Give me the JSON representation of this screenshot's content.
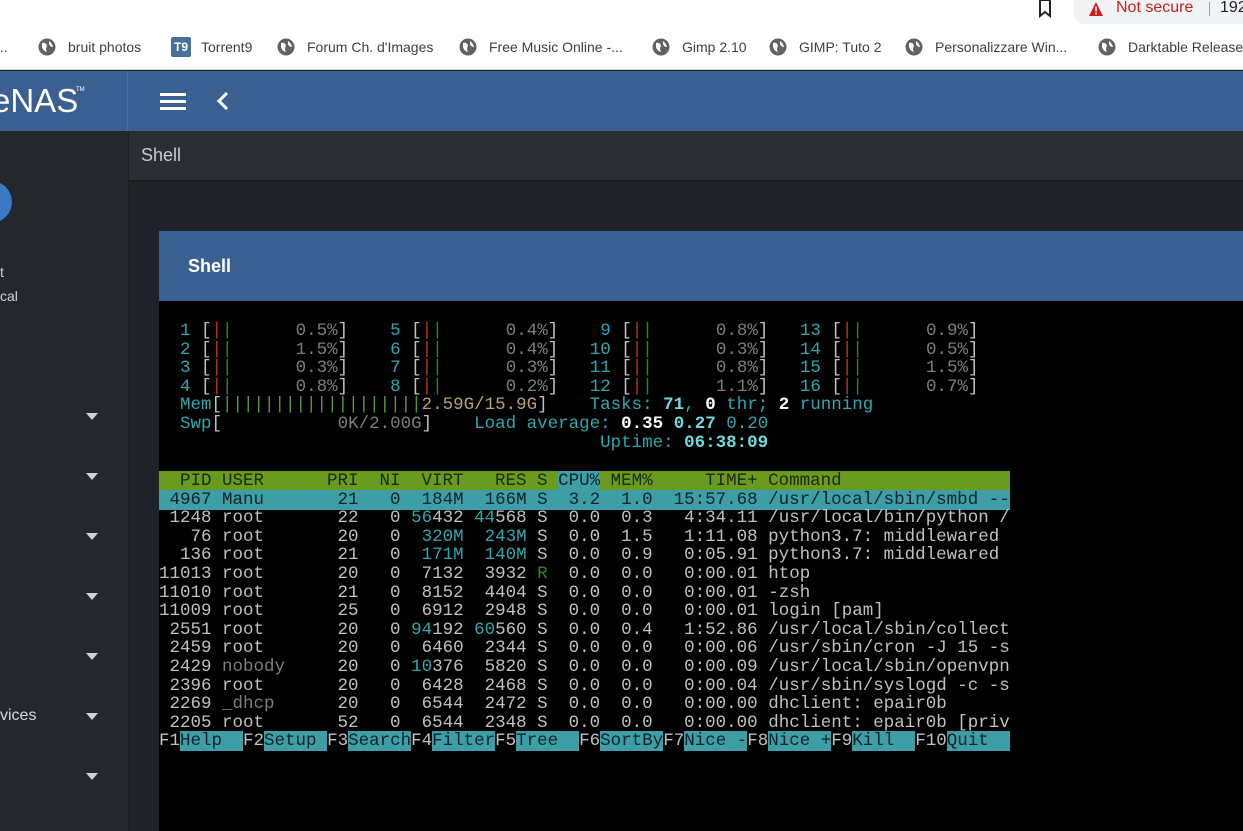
{
  "browser": {
    "not_secure": "Not secure",
    "url_fragment": "192",
    "bookmarks": [
      {
        "label": "bruit photos",
        "icon": "globe-icon"
      },
      {
        "label": "Torrent9",
        "icon": "torrent9-favicon"
      },
      {
        "label": "Forum Ch. d'Images",
        "icon": "globe-icon"
      },
      {
        "label": "Free Music Online -...",
        "icon": "globe-icon"
      },
      {
        "label": "Gimp 2.10",
        "icon": "globe-icon"
      },
      {
        "label": "GIMP: Tuto 2",
        "icon": "globe-icon"
      },
      {
        "label": "Personalizzare Win...",
        "icon": "globe-icon"
      },
      {
        "label": "Darktable Release",
        "icon": "globe-icon"
      }
    ],
    "torrent9_badge": "T9"
  },
  "app": {
    "logo": "eNAS",
    "logo_tm": "TM"
  },
  "sidebar": {
    "small_text": "t",
    "role_text": "cal",
    "items": [
      {
        "label": ""
      },
      {
        "label": ""
      },
      {
        "label": ""
      },
      {
        "label": ""
      },
      {
        "label": ""
      },
      {
        "label": "vices"
      },
      {
        "label": ""
      }
    ]
  },
  "page": {
    "title": "Shell",
    "card_title": "Shell"
  },
  "terminal": {
    "cpu": [
      [
        "1",
        "0.5%"
      ],
      [
        "2",
        "1.5%"
      ],
      [
        "3",
        "0.3%"
      ],
      [
        "4",
        "0.8%"
      ],
      [
        "5",
        "0.4%"
      ],
      [
        "6",
        "0.4%"
      ],
      [
        "7",
        "0.3%"
      ],
      [
        "8",
        "0.2%"
      ],
      [
        "9",
        "0.8%"
      ],
      [
        "10",
        "0.3%"
      ],
      [
        "11",
        "0.8%"
      ],
      [
        "12",
        "1.1%"
      ],
      [
        "13",
        "0.9%"
      ],
      [
        "14",
        "0.5%"
      ],
      [
        "15",
        "1.5%"
      ],
      [
        "16",
        "0.7%"
      ]
    ],
    "mem_label": "Mem",
    "mem_value": "2.59G/15.9G",
    "swp_label": "Swp",
    "swp_value": "0K/2.00G",
    "tasks_label": "Tasks:",
    "tasks_count": "71",
    "tasks_thr": "0",
    "thr_word": "thr;",
    "tasks_running": "2",
    "running_word": "running",
    "load_label": "Load average:",
    "load1": "0.35",
    "load5": "0.27",
    "load15": "0.20",
    "uptime_label": "Uptime:",
    "uptime": "06:38:09",
    "columns": [
      "PID",
      "USER",
      "PRI",
      "NI",
      "VIRT",
      "RES",
      "S",
      "CPU%",
      "MEM%",
      "TIME+",
      "Command"
    ],
    "processes": [
      {
        "pid": "4967",
        "user": "Manu",
        "pri": "21",
        "ni": "0",
        "virt": "184M",
        "res": "166M",
        "s": "S",
        "cpu": "3.2",
        "mem": "1.0",
        "time": "15:57.68",
        "cmd": "/usr/local/sbin/smbd --"
      },
      {
        "pid": "1248",
        "user": "root",
        "pri": "22",
        "ni": "0",
        "virt": "56432",
        "res": "44568",
        "s": "S",
        "cpu": "0.0",
        "mem": "0.3",
        "time": "4:34.11",
        "cmd": "/usr/local/bin/python /"
      },
      {
        "pid": "76",
        "user": "root",
        "pri": "20",
        "ni": "0",
        "virt": "320M",
        "res": "243M",
        "s": "S",
        "cpu": "0.0",
        "mem": "1.5",
        "time": "1:11.08",
        "cmd": "python3.7: middlewared"
      },
      {
        "pid": "136",
        "user": "root",
        "pri": "21",
        "ni": "0",
        "virt": "171M",
        "res": "140M",
        "s": "S",
        "cpu": "0.0",
        "mem": "0.9",
        "time": "0:05.91",
        "cmd": "python3.7: middlewared"
      },
      {
        "pid": "11013",
        "user": "root",
        "pri": "20",
        "ni": "0",
        "virt": "7132",
        "res": "3932",
        "s": "R",
        "cpu": "0.0",
        "mem": "0.0",
        "time": "0:00.01",
        "cmd": "htop"
      },
      {
        "pid": "11010",
        "user": "root",
        "pri": "21",
        "ni": "0",
        "virt": "8152",
        "res": "4404",
        "s": "S",
        "cpu": "0.0",
        "mem": "0.0",
        "time": "0:00.01",
        "cmd": "-zsh"
      },
      {
        "pid": "11009",
        "user": "root",
        "pri": "25",
        "ni": "0",
        "virt": "6912",
        "res": "2948",
        "s": "S",
        "cpu": "0.0",
        "mem": "0.0",
        "time": "0:00.01",
        "cmd": "login [pam]"
      },
      {
        "pid": "2551",
        "user": "root",
        "pri": "20",
        "ni": "0",
        "virt": "94192",
        "res": "60560",
        "s": "S",
        "cpu": "0.0",
        "mem": "0.4",
        "time": "1:52.86",
        "cmd": "/usr/local/sbin/collect"
      },
      {
        "pid": "2459",
        "user": "root",
        "pri": "20",
        "ni": "0",
        "virt": "6460",
        "res": "2344",
        "s": "S",
        "cpu": "0.0",
        "mem": "0.0",
        "time": "0:00.06",
        "cmd": "/usr/sbin/cron -J 15 -s"
      },
      {
        "pid": "2429",
        "user": "nobody",
        "pri": "20",
        "ni": "0",
        "virt": "10376",
        "res": "5820",
        "s": "S",
        "cpu": "0.0",
        "mem": "0.0",
        "time": "0:00.09",
        "cmd": "/usr/local/sbin/openvpn"
      },
      {
        "pid": "2396",
        "user": "root",
        "pri": "20",
        "ni": "0",
        "virt": "6428",
        "res": "2468",
        "s": "S",
        "cpu": "0.0",
        "mem": "0.0",
        "time": "0:00.04",
        "cmd": "/usr/sbin/syslogd -c -s"
      },
      {
        "pid": "2269",
        "user": "_dhcp",
        "pri": "20",
        "ni": "0",
        "virt": "6544",
        "res": "2472",
        "s": "S",
        "cpu": "0.0",
        "mem": "0.0",
        "time": "0:00.00",
        "cmd": "dhclient: epair0b"
      },
      {
        "pid": "2205",
        "user": "root",
        "pri": "52",
        "ni": "0",
        "virt": "6544",
        "res": "2348",
        "s": "S",
        "cpu": "0.0",
        "mem": "0.0",
        "time": "0:00.00",
        "cmd": "dhclient: epair0b [priv"
      }
    ],
    "fkeys": [
      {
        "key": "F1",
        "label": "Help"
      },
      {
        "key": "F2",
        "label": "Setup"
      },
      {
        "key": "F3",
        "label": "Search"
      },
      {
        "key": "F4",
        "label": "Filter"
      },
      {
        "key": "F5",
        "label": "Tree"
      },
      {
        "key": "F6",
        "label": "SortBy"
      },
      {
        "key": "F7",
        "label": "Nice -"
      },
      {
        "key": "F8",
        "label": "Nice +"
      },
      {
        "key": "F9",
        "label": "Kill"
      },
      {
        "key": "F10",
        "label": "Quit"
      }
    ]
  }
}
